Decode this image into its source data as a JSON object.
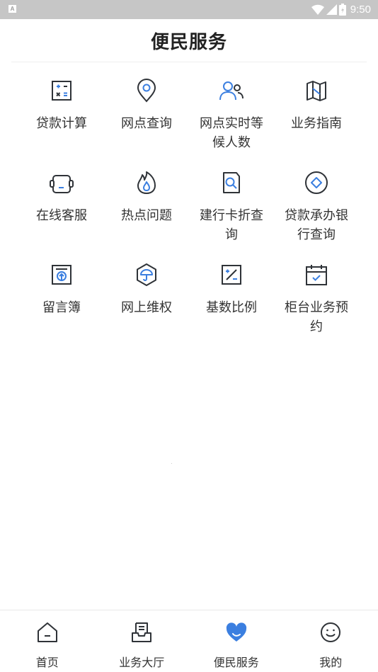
{
  "status_bar": {
    "time": "9:50",
    "app_badge": "A"
  },
  "header": {
    "title": "便民服务"
  },
  "services": [
    {
      "label": "贷款计算",
      "icon": "calculator-icon"
    },
    {
      "label": "网点查询",
      "icon": "location-pin-icon"
    },
    {
      "label": "网点实时等候人数",
      "icon": "users-icon"
    },
    {
      "label": "业务指南",
      "icon": "map-icon"
    },
    {
      "label": "在线客服",
      "icon": "headset-icon"
    },
    {
      "label": "热点问题",
      "icon": "flame-icon"
    },
    {
      "label": "建行卡折查询",
      "icon": "document-search-icon"
    },
    {
      "label": "贷款承办银行查询",
      "icon": "diamond-circle-icon"
    },
    {
      "label": "留言簿",
      "icon": "upload-box-icon"
    },
    {
      "label": "网上维权",
      "icon": "umbrella-shield-icon"
    },
    {
      "label": "基数比例",
      "icon": "percent-icon"
    },
    {
      "label": "柜台业务预约",
      "icon": "calendar-check-icon"
    }
  ],
  "bottom_nav": [
    {
      "label": "首页",
      "icon": "home-icon",
      "active": false
    },
    {
      "label": "业务大厅",
      "icon": "tray-icon",
      "active": false
    },
    {
      "label": "便民服务",
      "icon": "heart-icon",
      "active": true
    },
    {
      "label": "我的",
      "icon": "smiley-icon",
      "active": false
    }
  ],
  "colors": {
    "accent": "#3b7fe0",
    "icon_dark": "#2f3338",
    "statusbar": "#c6c6c6"
  }
}
